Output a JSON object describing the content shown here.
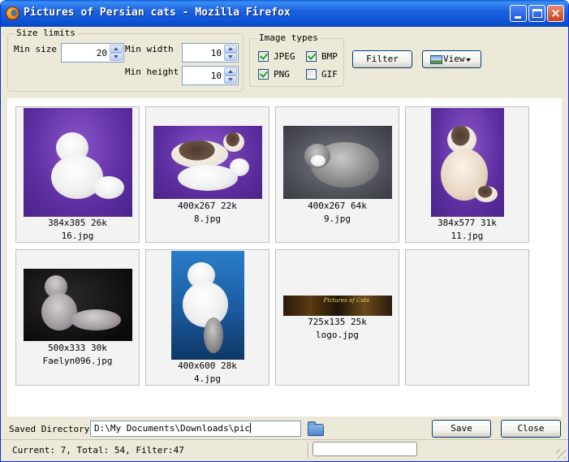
{
  "window": {
    "title": "Pictures of Persian cats - Mozilla Firefox",
    "buttons": {
      "minimize": "minimize",
      "maximize": "maximize",
      "close": "×"
    }
  },
  "size_limits": {
    "legend": "Size limits",
    "min_size_label": "Min size",
    "min_size_value": "20",
    "min_width_label": "Min width",
    "min_width_value": "10",
    "min_height_label": "Min height",
    "min_height_value": "10"
  },
  "image_types": {
    "legend": "Image types",
    "items": [
      {
        "label": "JPEG",
        "checked": true
      },
      {
        "label": "BMP",
        "checked": true
      },
      {
        "label": "PNG",
        "checked": true
      },
      {
        "label": "GIF",
        "checked": false
      }
    ]
  },
  "toolbar": {
    "filter_label": "Filter",
    "view_label": "View",
    "view_icon": "picture-icon"
  },
  "images": [
    {
      "size": "384x385 26k",
      "name": "16.jpg",
      "style": "purple-white-cat"
    },
    {
      "size": "400x267 22k",
      "name": "8.jpg",
      "style": "purple-two-cats"
    },
    {
      "size": "400x267 64k",
      "name": "9.jpg",
      "style": "grey-cat"
    },
    {
      "size": "384x577 31k",
      "name": "11.jpg",
      "style": "purple-colorpoint-cat"
    },
    {
      "size": "500x333 30k",
      "name": "Faelyn096.jpg",
      "style": "black-lilac-cat"
    },
    {
      "size": "400x600 28k",
      "name": "4.jpg",
      "style": "blue-white-cat"
    },
    {
      "size": "725x135 25k",
      "name": "logo.jpg",
      "style": "logo-banner",
      "logo_text": "Pictures of Cats"
    },
    {
      "size": "",
      "name": "",
      "style": "empty"
    }
  ],
  "bottom": {
    "saved_dir_label": "Saved Directory",
    "saved_dir_value": "D:\\My Documents\\Downloads\\pic",
    "folder_icon": "folder-icon",
    "save_label": "Save",
    "close_label": "Close"
  },
  "status": {
    "text": "Current: 7, Total: 54, Filter:47"
  },
  "colors": {
    "titlebar": "#0a4fd0",
    "window_bg": "#ece9d8",
    "check": "#21a121"
  }
}
